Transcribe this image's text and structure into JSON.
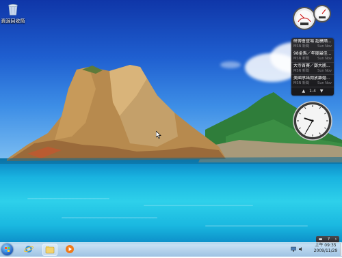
{
  "desktop": {
    "recycle_bin_label": "資源回收筒"
  },
  "feed": {
    "items": [
      {
        "title": "研博會登場 超模隔...",
        "source": "MSN 新聞",
        "date": "Sun Nov"
      },
      {
        "title": "98金馬／年度最佳...",
        "source": "MSN 新聞",
        "date": "Sun Nov"
      },
      {
        "title": "大寺首賽／鄭大勝...",
        "source": "MSN 新聞",
        "date": "Sun Nov"
      },
      {
        "title": "美國承諾開放離婚...",
        "source": "MSN 新聞",
        "date": "Sun Nov"
      }
    ],
    "pager": "1-4"
  },
  "clock": {
    "time_of_day": "上午 09:35",
    "date": "2009/11/29",
    "analog_hour": 9,
    "analog_minute": 35
  },
  "colors": {
    "taskbar": "#bcd8ef",
    "gadget_dark": "#1e1e22"
  },
  "icons": {
    "start": "windows-orb-icon",
    "ie": "internet-explorer-icon",
    "explorer": "folder-icon",
    "media": "media-player-icon"
  }
}
